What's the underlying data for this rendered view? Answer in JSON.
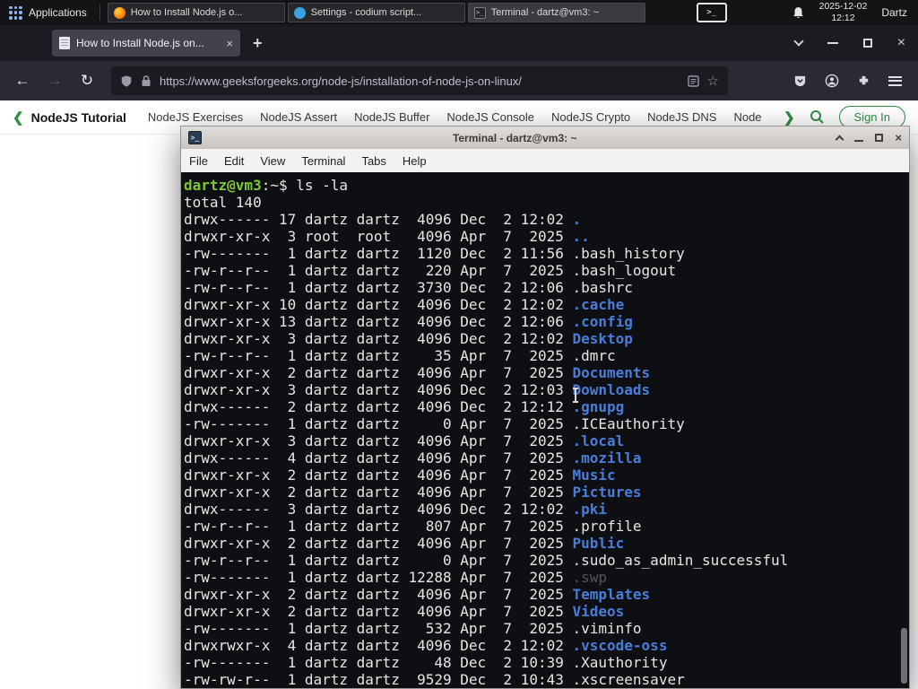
{
  "colors": {
    "gfg_green": "#2f8d46",
    "terminal_dir_blue": "#4a7dd9",
    "terminal_prompt_green": "#7dc832",
    "firefox_tabbar": "#1c1b22",
    "firefox_toolbar": "#2b2a33",
    "active_tab": "#42414d",
    "terminal_bg": "#0e0f12"
  },
  "panel": {
    "applications_label": "Applications",
    "window_buttons": [
      {
        "label": "How to Install Node.js o...",
        "icon": "firefox"
      },
      {
        "label": "Settings - codium script...",
        "icon": "codium"
      },
      {
        "label": "Terminal - dartz@vm3: ~",
        "icon": "terminal"
      }
    ],
    "tray_terminal_glyph": ">_",
    "clock_date": "2025-12-02",
    "clock_time": "12:12",
    "user_label": "Dartz"
  },
  "browser": {
    "tab_title": "How to Install Node.js on...",
    "url": "https://www.geeksforgeeks.org/node-js/installation-of-node-js-on-linux/"
  },
  "site_nav": {
    "title": "NodeJS Tutorial",
    "links": [
      "NodeJS Exercises",
      "NodeJS Assert",
      "NodeJS Buffer",
      "NodeJS Console",
      "NodeJS Crypto",
      "NodeJS DNS",
      "Node"
    ],
    "sign_in_label": "Sign In"
  },
  "terminal": {
    "title": "Terminal - dartz@vm3: ~",
    "icon_glyph": ">_",
    "menu": [
      "File",
      "Edit",
      "View",
      "Terminal",
      "Tabs",
      "Help"
    ],
    "prompt_user": "dartz@vm3",
    "prompt_suffix": ":~$",
    "command": " ls -la",
    "total_line": "total 140",
    "listing": [
      {
        "meta": "drwx------ 17 dartz dartz  4096 Dec  2 12:02 ",
        "name": ".",
        "type": "dir"
      },
      {
        "meta": "drwxr-xr-x  3 root  root   4096 Apr  7  2025 ",
        "name": "..",
        "type": "dir"
      },
      {
        "meta": "-rw-------  1 dartz dartz  1120 Dec  2 11:56 ",
        "name": ".bash_history",
        "type": "file"
      },
      {
        "meta": "-rw-r--r--  1 dartz dartz   220 Apr  7  2025 ",
        "name": ".bash_logout",
        "type": "file"
      },
      {
        "meta": "-rw-r--r--  1 dartz dartz  3730 Dec  2 12:06 ",
        "name": ".bashrc",
        "type": "file"
      },
      {
        "meta": "drwxr-xr-x 10 dartz dartz  4096 Dec  2 12:02 ",
        "name": ".cache",
        "type": "dir"
      },
      {
        "meta": "drwxr-xr-x 13 dartz dartz  4096 Dec  2 12:06 ",
        "name": ".config",
        "type": "dir"
      },
      {
        "meta": "drwxr-xr-x  3 dartz dartz  4096 Dec  2 12:02 ",
        "name": "Desktop",
        "type": "dir"
      },
      {
        "meta": "-rw-r--r--  1 dartz dartz    35 Apr  7  2025 ",
        "name": ".dmrc",
        "type": "file"
      },
      {
        "meta": "drwxr-xr-x  2 dartz dartz  4096 Apr  7  2025 ",
        "name": "Documents",
        "type": "dir"
      },
      {
        "meta": "drwxr-xr-x  3 dartz dartz  4096 Dec  2 12:03 ",
        "name": "Downloads",
        "type": "dir"
      },
      {
        "meta": "drwx------  2 dartz dartz  4096 Dec  2 12:12 ",
        "name": ".gnupg",
        "type": "dir"
      },
      {
        "meta": "-rw-------  1 dartz dartz     0 Apr  7  2025 ",
        "name": ".ICEauthority",
        "type": "file"
      },
      {
        "meta": "drwxr-xr-x  3 dartz dartz  4096 Apr  7  2025 ",
        "name": ".local",
        "type": "dir"
      },
      {
        "meta": "drwx------  4 dartz dartz  4096 Apr  7  2025 ",
        "name": ".mozilla",
        "type": "dir"
      },
      {
        "meta": "drwxr-xr-x  2 dartz dartz  4096 Apr  7  2025 ",
        "name": "Music",
        "type": "dir"
      },
      {
        "meta": "drwxr-xr-x  2 dartz dartz  4096 Apr  7  2025 ",
        "name": "Pictures",
        "type": "dir"
      },
      {
        "meta": "drwx------  3 dartz dartz  4096 Dec  2 12:02 ",
        "name": ".pki",
        "type": "dir"
      },
      {
        "meta": "-rw-r--r--  1 dartz dartz   807 Apr  7  2025 ",
        "name": ".profile",
        "type": "file"
      },
      {
        "meta": "drwxr-xr-x  2 dartz dartz  4096 Apr  7  2025 ",
        "name": "Public",
        "type": "dir"
      },
      {
        "meta": "-rw-r--r--  1 dartz dartz     0 Apr  7  2025 ",
        "name": ".sudo_as_admin_successful",
        "type": "file"
      },
      {
        "meta": "-rw-------  1 dartz dartz 12288 Apr  7  2025 ",
        "name": ".swp",
        "type": "dim"
      },
      {
        "meta": "drwxr-xr-x  2 dartz dartz  4096 Apr  7  2025 ",
        "name": "Templates",
        "type": "dir"
      },
      {
        "meta": "drwxr-xr-x  2 dartz dartz  4096 Apr  7  2025 ",
        "name": "Videos",
        "type": "dir"
      },
      {
        "meta": "-rw-------  1 dartz dartz   532 Apr  7  2025 ",
        "name": ".viminfo",
        "type": "file"
      },
      {
        "meta": "drwxrwxr-x  4 dartz dartz  4096 Dec  2 12:02 ",
        "name": ".vscode-oss",
        "type": "dir"
      },
      {
        "meta": "-rw-------  1 dartz dartz    48 Dec  2 10:39 ",
        "name": ".Xauthority",
        "type": "file"
      },
      {
        "meta": "-rw-rw-r--  1 dartz dartz  9529 Dec  2 10:43 ",
        "name": ".xscreensaver",
        "type": "file"
      }
    ]
  }
}
